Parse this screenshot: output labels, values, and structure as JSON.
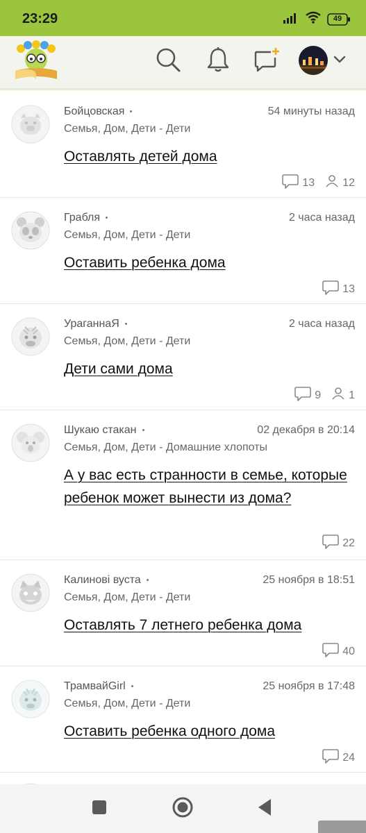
{
  "status_bar": {
    "time": "23:29",
    "battery": "49",
    "icons": [
      "signal-icon",
      "wifi-icon",
      "battery-icon"
    ]
  },
  "top_bar": {
    "icons": [
      "search-icon",
      "bell-icon",
      "new-message-icon",
      "chevron-down-icon"
    ]
  },
  "colors": {
    "status_bar": "#9bc53d",
    "top_bar": "#f3f4ee",
    "accent_orange": "#f5a623"
  },
  "posts": [
    {
      "author": "Бойцовская",
      "time": "54 минуты назад",
      "category": "Семья, Дом, Дети - Дети",
      "title": "Оставлять детей дома",
      "comments": "13",
      "participants": "12"
    },
    {
      "author": "Грабля",
      "time": "2 часа назад",
      "category": "Семья, Дом, Дети - Дети",
      "title": "Оставить ребенка дома",
      "comments": "13",
      "participants": ""
    },
    {
      "author": "УраганнаЯ",
      "time": "2 часа назад",
      "category": "Семья, Дом, Дети - Дети",
      "title": "Дети сами дома",
      "comments": "9",
      "participants": "1"
    },
    {
      "author": "Шукаю стакан",
      "time": "02 декабря в 20:14",
      "category": "Семья, Дом, Дети - Домашние хлопоты",
      "title": "А у вас есть странности в семье, которые ребенок может вынести из дома?",
      "comments": "22",
      "participants": ""
    },
    {
      "author": "Калинові вуста",
      "time": "25 ноября в 18:51",
      "category": "Семья, Дом, Дети - Дети",
      "title": "Оставлять 7 летнего ребенка дома",
      "comments": "40",
      "participants": ""
    },
    {
      "author": "ТрамвайGirl",
      "time": "25 ноября в 17:48",
      "category": "Семья, Дом, Дети - Дети",
      "title": "Оставить ребенка одного дома",
      "comments": "24",
      "participants": ""
    }
  ],
  "nav_bar": {
    "icons": [
      "recent-apps-icon",
      "home-icon",
      "back-icon"
    ]
  }
}
